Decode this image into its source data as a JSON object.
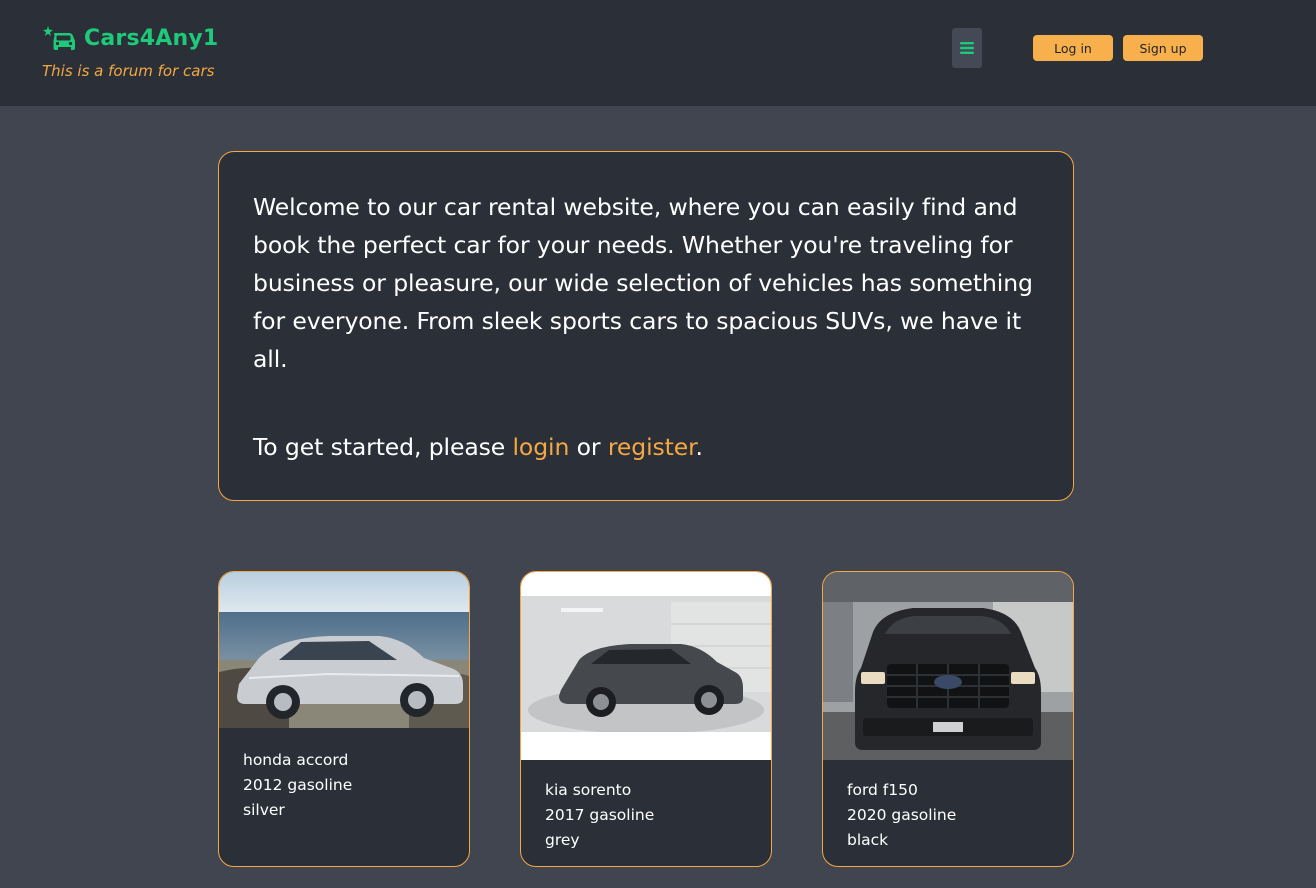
{
  "brand": {
    "name": "Cars4Any1",
    "tagline": "This is a forum for cars",
    "logo_icon": "car-sparkle-icon"
  },
  "header": {
    "menu_icon": "hamburger-menu-icon",
    "login_label": "Log in",
    "signup_label": "Sign up"
  },
  "welcome": {
    "intro": "Welcome to our car rental website, where you can easily find and book the perfect car for your needs. Whether you're traveling for business or pleasure, our wide selection of vehicles has something for everyone. From sleek sports cars to spacious SUVs, we have it all.",
    "start_prefix": "To get started, please ",
    "login_link": "login",
    "or_text": " or ",
    "register_link": "register",
    "end_text": "."
  },
  "cars": [
    {
      "name": "honda accord",
      "year_fuel": "2012 gasoline",
      "color": "silver"
    },
    {
      "name": "kia sorento",
      "year_fuel": "2017 gasoline",
      "color": "grey"
    },
    {
      "name": "ford f150",
      "year_fuel": "2020 gasoline",
      "color": "black"
    }
  ],
  "colors": {
    "accent": "#f5a742",
    "brand_green": "#1ec97a",
    "header_bg": "#2b3038",
    "page_bg": "#404550",
    "card_bg": "#2b3038"
  }
}
